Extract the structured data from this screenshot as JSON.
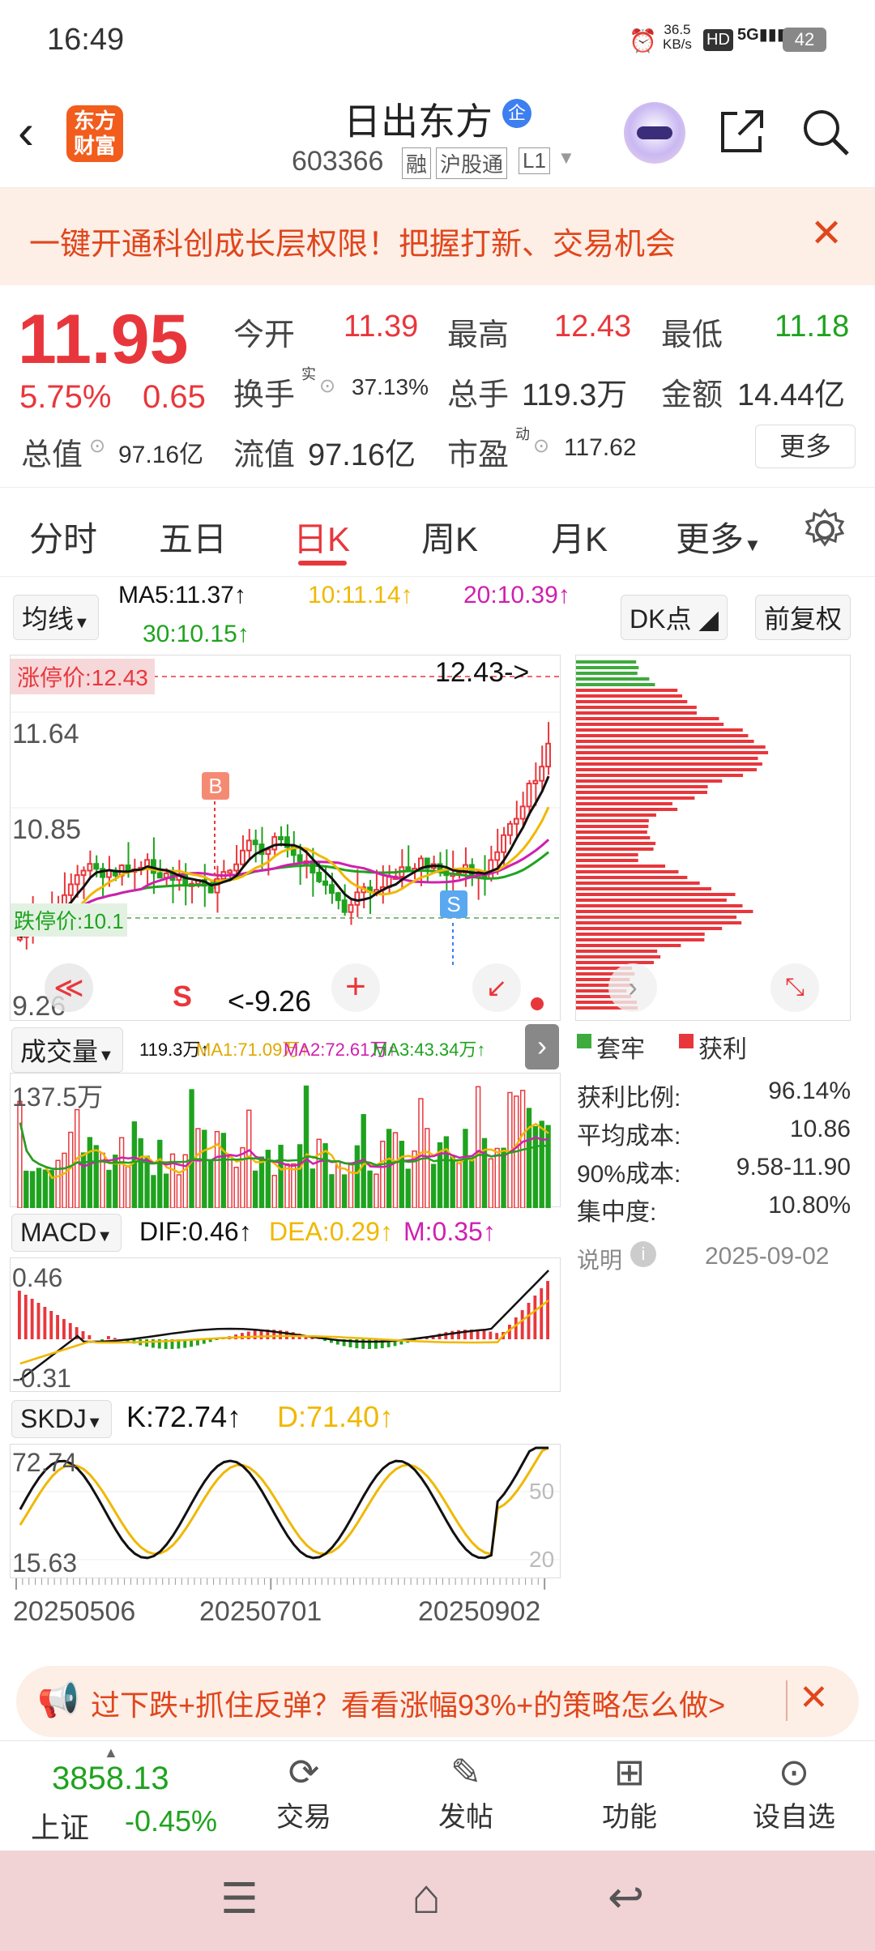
{
  "status": {
    "time": "16:49",
    "net_speed": "36.5",
    "net_unit": "KB/s",
    "battery": "42"
  },
  "header": {
    "logo": "东方财富",
    "name": "日出东方",
    "badge": "企",
    "code": "603366",
    "tags": [
      "融",
      "沪股通",
      "L1"
    ]
  },
  "banner": {
    "text": "一键开通科创成长层权限！把握打新、交易机会"
  },
  "quote": {
    "price": "11.95",
    "pct": "5.75%",
    "chg": "0.65",
    "open_l": "今开",
    "open_v": "11.39",
    "high_l": "最高",
    "high_v": "12.43",
    "low_l": "最低",
    "low_v": "11.18",
    "turnover_l": "换手",
    "turnover_sup": "实",
    "turnover_v": "37.13%",
    "vol_l": "总手",
    "vol_v": "119.3万",
    "amt_l": "金额",
    "amt_v": "14.44亿",
    "mcap_l": "总值",
    "mcap_v": "97.16亿",
    "float_l": "流值",
    "float_v": "97.16亿",
    "pe_l": "市盈",
    "pe_sup": "动",
    "pe_v": "117.62",
    "more": "更多"
  },
  "tabs": [
    "分时",
    "五日",
    "日K",
    "周K",
    "月K",
    "更多"
  ],
  "ma": {
    "label": "均线",
    "ma5": "MA5:11.37↑",
    "ma10": "10:11.14↑",
    "ma20": "20:10.39↑",
    "ma30": "30:10.15↑",
    "dk": "DK点",
    "fq": "前复权"
  },
  "kchart": {
    "limit_label": "涨停价:12.43",
    "top_price": "12.43->",
    "p1": "11.64",
    "p2": "10.85",
    "support": "跌停价:10.1",
    "low": "9.26",
    "low_mark": "<-9.26",
    "b": "B",
    "s": "S",
    "s2": "S",
    "lt": "≪",
    "plus": "+"
  },
  "volume": {
    "label": "成交量",
    "v": "119.3万↑",
    "ma1": "MA1:71.09万↑",
    "ma2": "MA2:72.61万↑",
    "ma3": "MA3:43.34万↑",
    "max": "137.5万"
  },
  "macd": {
    "label": "MACD",
    "dif": "DIF:0.46↑",
    "dea": "DEA:0.29↑",
    "m": "M:0.35↑",
    "top": "0.46",
    "bottom": "-0.31"
  },
  "skdj": {
    "label": "SKDJ",
    "k": "K:72.74↑",
    "d": "D:71.40↑",
    "top": "72.74",
    "bottom": "15.63",
    "r50": "50",
    "r20": "20"
  },
  "dates": [
    "20250506",
    "20250701",
    "20250902"
  ],
  "chips": {
    "trapped": "套牢",
    "profit": "获利",
    "rows": [
      [
        "获利比例:",
        "96.14%"
      ],
      [
        "平均成本:",
        "10.86"
      ],
      [
        "90%成本:",
        "9.58-11.90"
      ],
      [
        "集中度:",
        "10.80%"
      ]
    ],
    "note": "说明",
    "date": "2025-09-02"
  },
  "ad": {
    "text": "过下跌+抓住反弹？看看涨幅93%+的策略怎么做>"
  },
  "bottom": {
    "index": "3858.13",
    "index_name": "上证",
    "index_chg": "-0.45%",
    "items": [
      "交易",
      "发帖",
      "功能",
      "设自选"
    ]
  },
  "colors": {
    "up": "#e8373c",
    "down": "#1fa31f",
    "ma5": "#111111",
    "ma10": "#f0b800",
    "ma20": "#d01fb0",
    "ma30": "#1fa31f"
  }
}
